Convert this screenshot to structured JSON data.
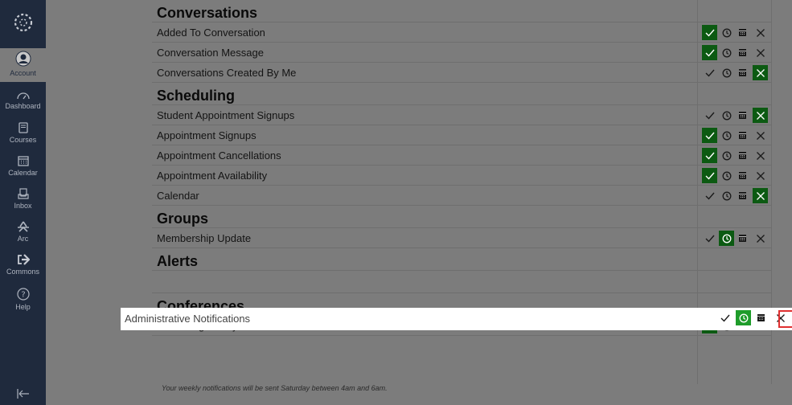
{
  "nav": {
    "items": [
      {
        "key": "account",
        "label": "Account",
        "icon": "user-icon"
      },
      {
        "key": "dashboard",
        "label": "Dashboard",
        "icon": "dashboard-icon"
      },
      {
        "key": "courses",
        "label": "Courses",
        "icon": "book-icon"
      },
      {
        "key": "calendar",
        "label": "Calendar",
        "icon": "calendar-icon"
      },
      {
        "key": "inbox",
        "label": "Inbox",
        "icon": "inbox-icon"
      },
      {
        "key": "arc",
        "label": "Arc",
        "icon": "arc-icon"
      },
      {
        "key": "commons",
        "label": "Commons",
        "icon": "commons-icon"
      },
      {
        "key": "help",
        "label": "Help",
        "icon": "help-icon"
      }
    ]
  },
  "rows": [
    {
      "type": "category",
      "name": "Conversations"
    },
    {
      "type": "item",
      "name": "Added To Conversation",
      "selected": "immediately"
    },
    {
      "type": "item",
      "name": "Conversation Message",
      "selected": "immediately"
    },
    {
      "type": "item",
      "name": "Conversations Created By Me",
      "selected": "off"
    },
    {
      "type": "category",
      "name": "Scheduling"
    },
    {
      "type": "item",
      "name": "Student Appointment Signups",
      "selected": "off"
    },
    {
      "type": "item",
      "name": "Appointment Signups",
      "selected": "immediately"
    },
    {
      "type": "item",
      "name": "Appointment Cancellations",
      "selected": "immediately"
    },
    {
      "type": "item",
      "name": "Appointment Availability",
      "selected": "immediately"
    },
    {
      "type": "item",
      "name": "Calendar",
      "selected": "off"
    },
    {
      "type": "category",
      "name": "Groups"
    },
    {
      "type": "item",
      "name": "Membership Update",
      "selected": "daily"
    },
    {
      "type": "category",
      "name": "Alerts"
    },
    {
      "type": "spacer"
    },
    {
      "type": "category",
      "name": "Conferences"
    },
    {
      "type": "item",
      "name": "Recording Ready",
      "selected": "immediately"
    }
  ],
  "highlighted": {
    "name": "Administrative Notifications",
    "selected": "daily"
  },
  "footnote": "Your weekly notifications will be sent Saturday between 4am and 6am.",
  "colors": {
    "nav_bg": "#1f2a3d",
    "selected_bg": "#0c5a12",
    "highlight_selected": "#1e9c2a",
    "focus_border": "#e03030"
  }
}
